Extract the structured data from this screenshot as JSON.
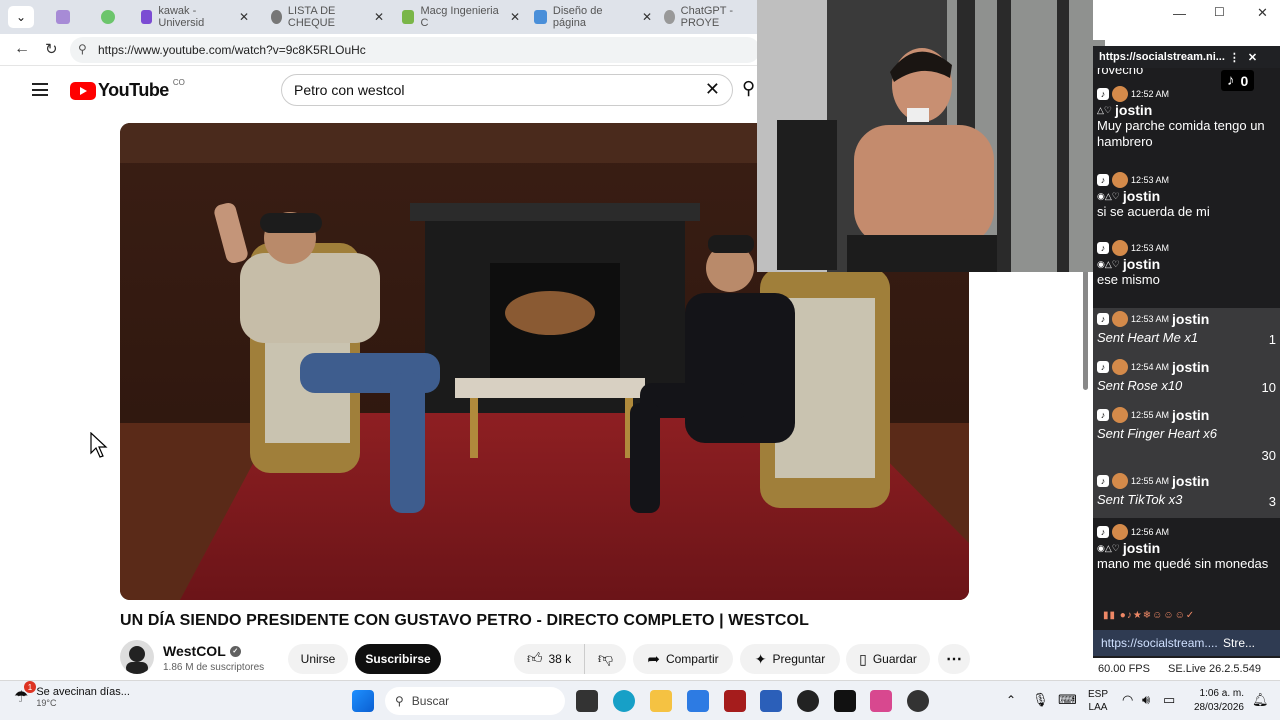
{
  "browser": {
    "tabs": [
      {
        "label": "",
        "color": "#a78bd6"
      },
      {
        "label": "",
        "color": "#6cc56c"
      },
      {
        "label": "kawak - Universid",
        "color": "#7b4bd3"
      },
      {
        "label": "LISTA DE CHEQUE",
        "color": "#666"
      },
      {
        "label": "Macg Ingenieria C",
        "color": "#7ab648"
      },
      {
        "label": "Diseño de página",
        "color": "#4a8fd9"
      },
      {
        "label": "ChatGPT - PROYE",
        "color": "#888"
      }
    ],
    "url": "https://www.youtube.com/watch?v=9c8K5RLOuHc"
  },
  "youtube": {
    "logo_text": "YouTube",
    "region": "CO",
    "search_value": "Petro con westcol",
    "video_title": "UN DÍA SIENDO PRESIDENTE CON GUSTAVO PETRO - DIRECTO COMPLETO | WESTCOL",
    "channel": {
      "name": "WestCOL",
      "subscribers": "1.86 M de suscriptores"
    },
    "join_label": "Unirse",
    "subscribe_label": "Suscribirse",
    "likes": "38 k",
    "share_label": "Compartir",
    "ask_label": "Preguntar",
    "save_label": "Guardar"
  },
  "chat": {
    "header_url": "https://socialstream.ni...",
    "viewer_count": "0",
    "top_fragment": "rovecho",
    "messages": [
      {
        "time": "12:52 AM",
        "user": "jostin",
        "text": "Muy parche comida tengo un hambrero"
      },
      {
        "time": "12:53 AM",
        "user": "jostin",
        "text": "si se acuerda de mi"
      },
      {
        "time": "12:53 AM",
        "user": "jostin",
        "text": "ese mismo"
      }
    ],
    "gifts": [
      {
        "time": "12:53 AM",
        "user": "jostin",
        "gift": "Sent Heart Me x1",
        "count": "1"
      },
      {
        "time": "12:54 AM",
        "user": "jostin",
        "gift": "Sent Rose x10",
        "count": "10"
      },
      {
        "time": "12:55 AM",
        "user": "jostin",
        "gift": "Sent Finger Heart x6",
        "count": "30"
      },
      {
        "time": "12:55 AM",
        "user": "jostin",
        "gift": "Sent TikTok x3",
        "count": "3"
      }
    ],
    "last_message": {
      "time": "12:56 AM",
      "user": "jostin",
      "text": "mano me quedé sin monedas"
    },
    "footer_link": "https://socialstream....",
    "footer_tab": "Stre...",
    "fps": "60.00 FPS",
    "version": "SE.Live 26.2.5.549"
  },
  "taskbar": {
    "weather_text": "Se avecinan días...",
    "temperature": "19°C",
    "search_placeholder": "Buscar",
    "lang": "ESP",
    "region": "LAA",
    "time": "1:06 a. m.",
    "date": "28/03/2026",
    "badge": "1"
  }
}
